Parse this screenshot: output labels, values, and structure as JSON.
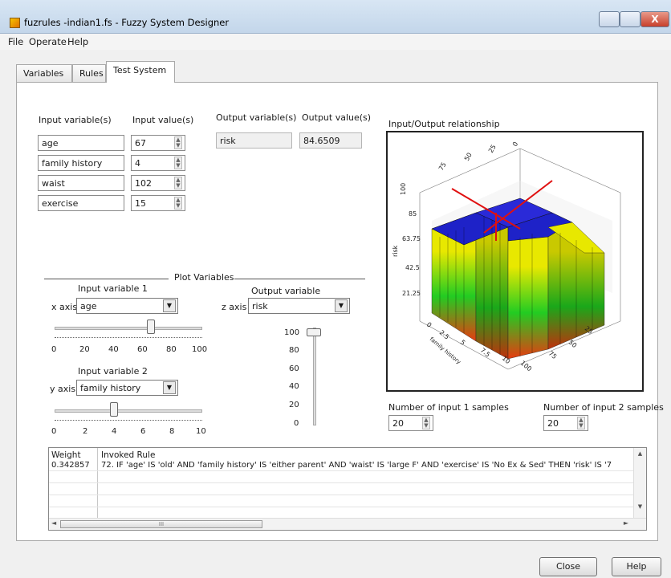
{
  "window": {
    "title": "fuzrules -indian1.fs - Fuzzy System Designer",
    "close_glyph": "X"
  },
  "menu": [
    "File",
    "Operate",
    "Help"
  ],
  "tabs": [
    "Variables",
    "Rules",
    "Test System"
  ],
  "io": {
    "input_variables_header": "Input variable(s)",
    "input_values_header": "Input value(s)",
    "output_variables_header": "Output variable(s)",
    "output_values_header": "Output value(s)",
    "inputs": [
      {
        "name": "age",
        "value": "67"
      },
      {
        "name": "family history",
        "value": "4"
      },
      {
        "name": "waist",
        "value": "102"
      },
      {
        "name": "exercise",
        "value": "15"
      }
    ],
    "outputs": [
      {
        "name": "risk",
        "value": "84.6509"
      }
    ]
  },
  "plot": {
    "title": "Input/Output relationship",
    "z_ticks": [
      "100",
      "85",
      "63.75",
      "42.5",
      "21.25"
    ],
    "z_axis_label": "risk",
    "back_ticks": [
      "75",
      "50",
      "25",
      "0"
    ],
    "bottom_x_ticks": [
      "25",
      "50",
      "75",
      "100"
    ],
    "bottom_y_ticks": [
      "0",
      "2.5",
      "5",
      "7.5",
      "10"
    ],
    "y_axis_label": "family history",
    "colors": {
      "top": "#1e22c8",
      "high": "#e8e800",
      "mid": "#22cc22",
      "low": "#e83a10"
    }
  },
  "plot_variables": {
    "legend": "Plot Variables",
    "input1_label": "Input variable 1",
    "x_axis_label": "x axis",
    "x_axis_value": "age",
    "x_slider_ticks": [
      "0",
      "20",
      "40",
      "60",
      "80",
      "100"
    ],
    "x_slider_level_pct": 65,
    "input2_label": "Input variable 2",
    "y_axis_label": "y axis",
    "y_axis_value": "family history",
    "y_slider_ticks": [
      "0",
      "2",
      "4",
      "6",
      "8",
      "10"
    ],
    "y_slider_level_pct": 40,
    "output_label": "Output variable",
    "z_axis_label": "z axis",
    "z_axis_value": "risk",
    "z_slider_ticks": [
      "100",
      "80",
      "60",
      "40",
      "20",
      "0"
    ],
    "z_slider_level_pct": 95
  },
  "samples": {
    "input1_label": "Number of input 1 samples",
    "input1_value": "20",
    "input2_label": "Number of input 2 samples",
    "input2_value": "20"
  },
  "rules_table": {
    "headers": [
      "Weight",
      "Invoked Rule"
    ],
    "rows": [
      {
        "weight": "0.342857",
        "rule": "72. IF 'age' IS 'old' AND 'family history' IS 'either parent' AND 'waist' IS 'large F' AND 'exercise' IS 'No Ex & Sed' THEN 'risk' IS '7"
      }
    ],
    "scroll_thumb_text": "III"
  },
  "buttons": {
    "close": "Close",
    "help": "Help"
  }
}
